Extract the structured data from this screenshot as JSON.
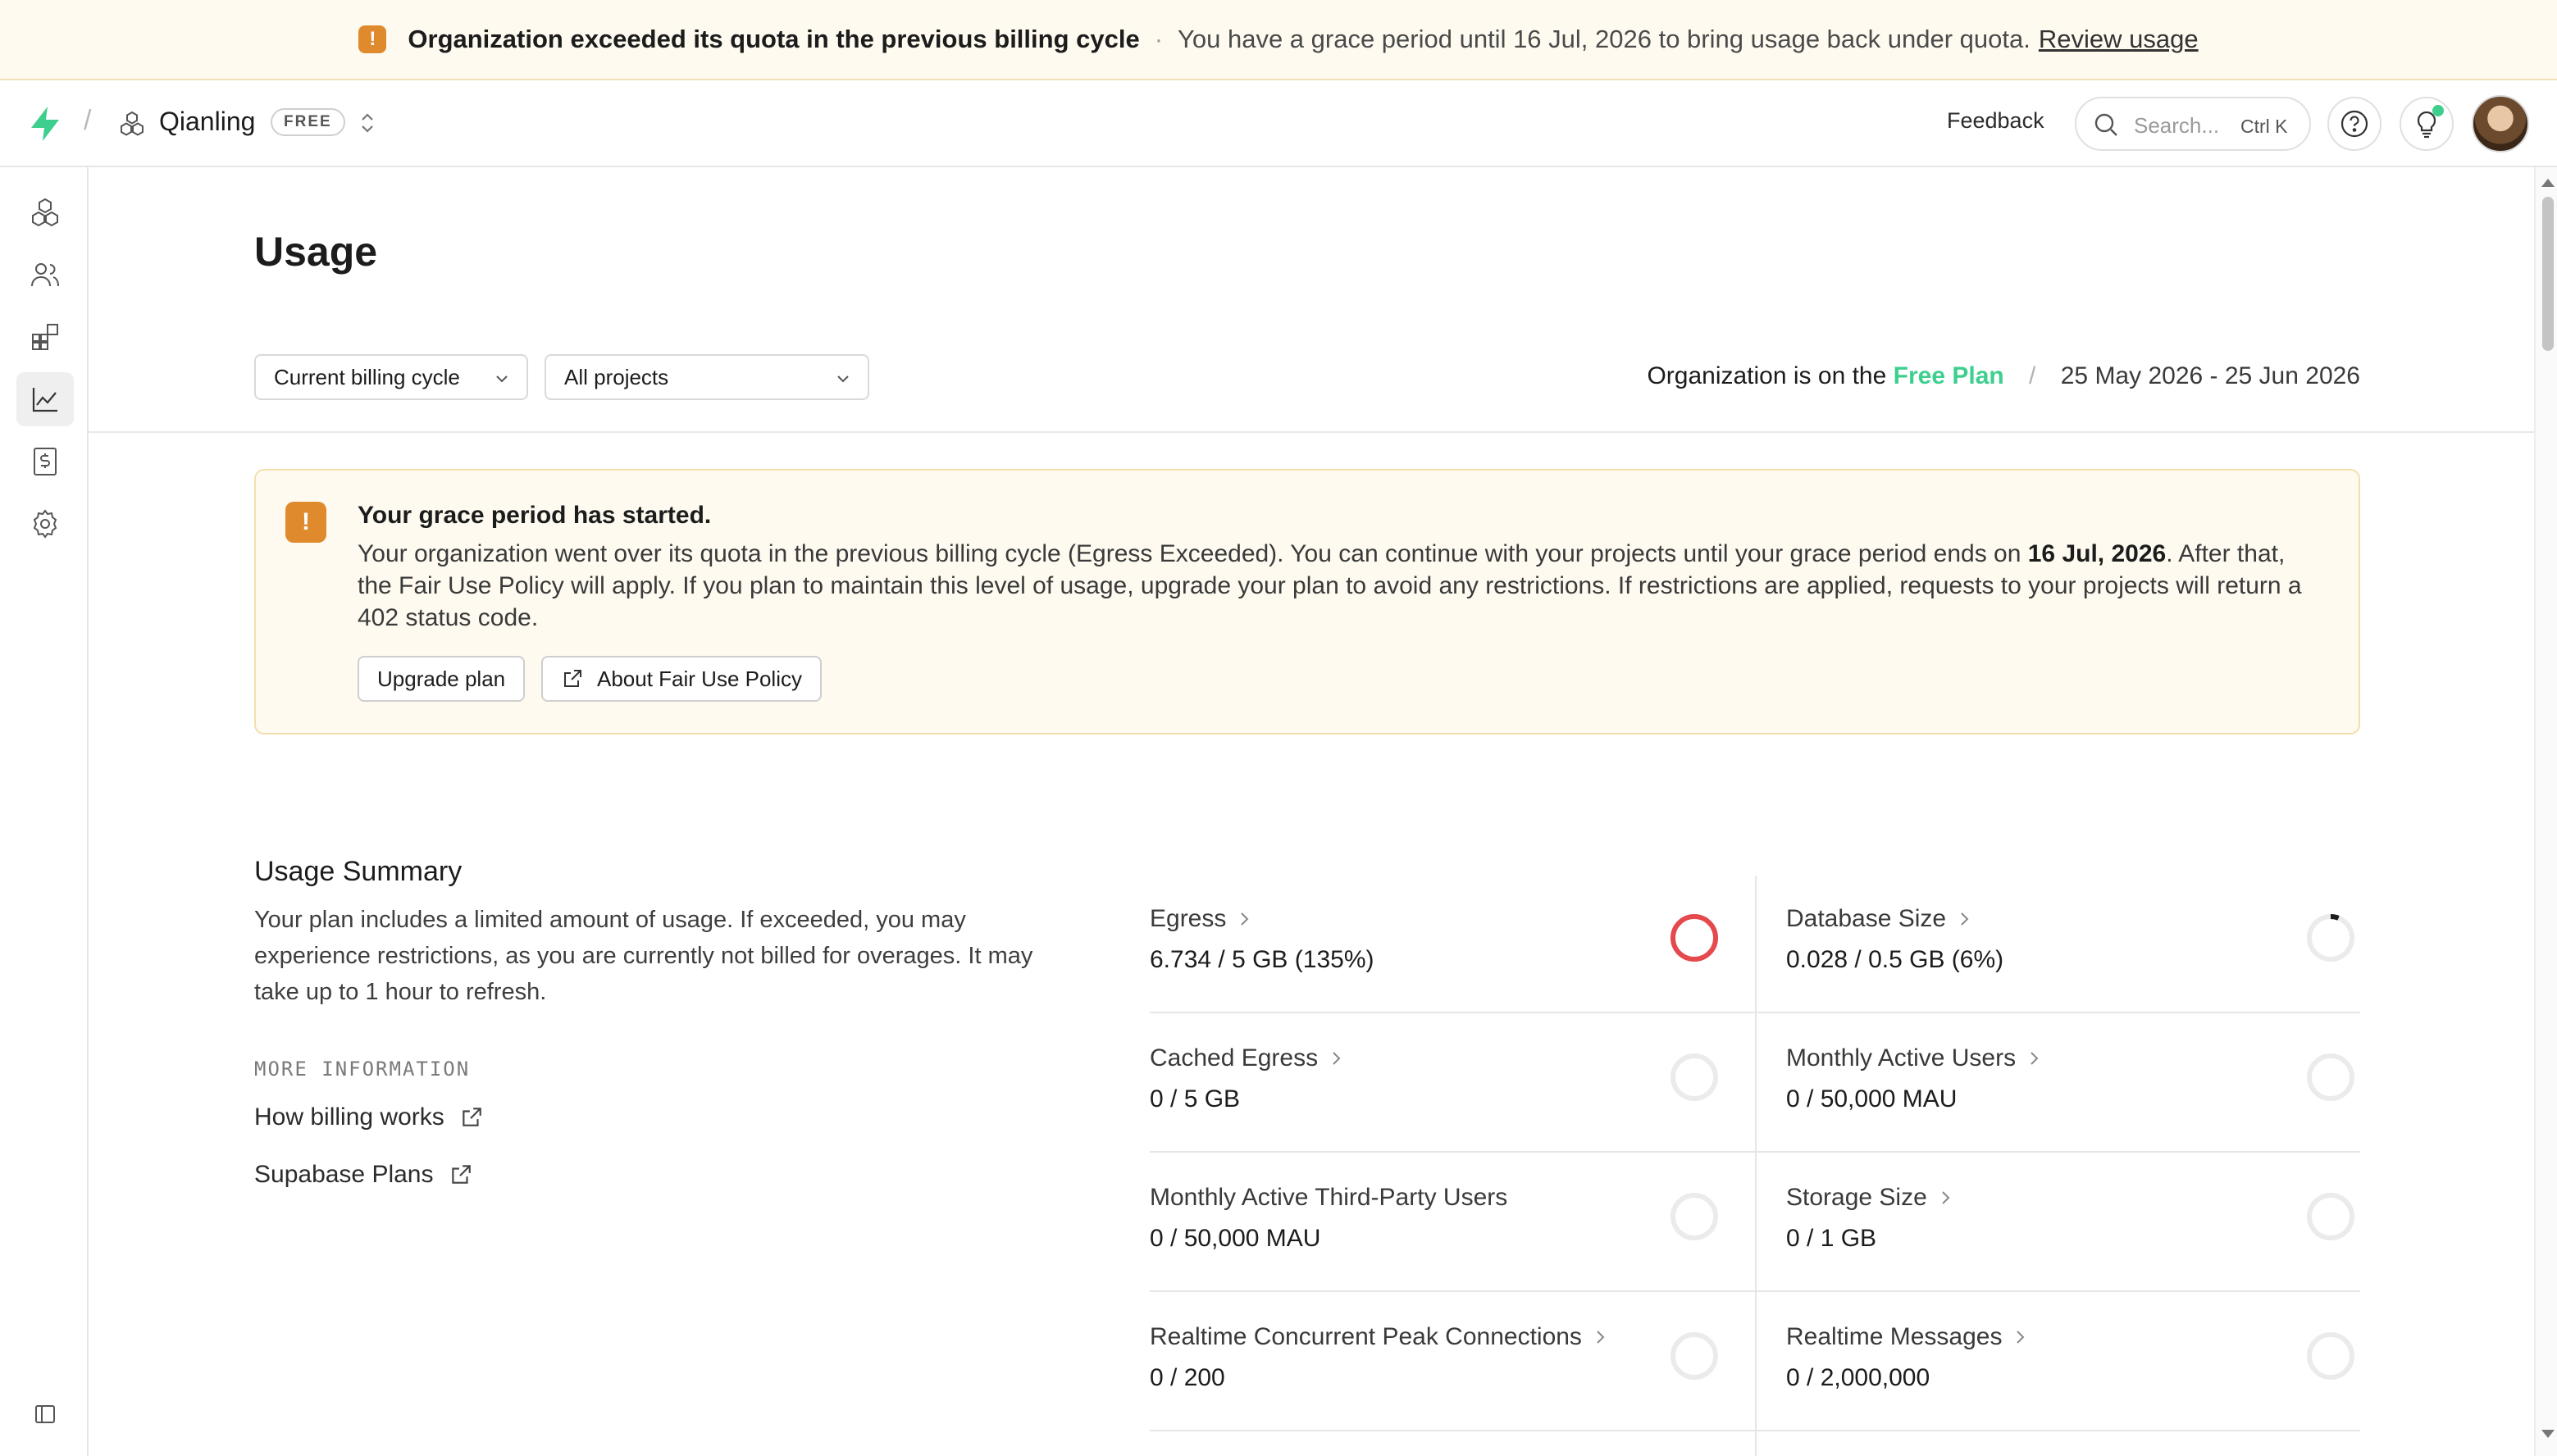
{
  "banner": {
    "title": "Organization exceeded its quota in the previous billing cycle",
    "separator": "·",
    "message": "You have a grace period until 16 Jul, 2026 to bring usage back under quota.",
    "link": "Review usage"
  },
  "topbar": {
    "org_name": "Qianling",
    "plan_badge": "FREE",
    "feedback": "Feedback",
    "search_placeholder": "Search...",
    "search_shortcut": "Ctrl K"
  },
  "sidebar": {
    "items": [
      "projects-icon",
      "team-icon",
      "integrations-icon",
      "usage-icon",
      "billing-icon",
      "settings-icon"
    ],
    "active": "usage-icon"
  },
  "page": {
    "title": "Usage",
    "billing_cycle_select": "Current billing cycle",
    "projects_select": "All projects",
    "plan_prefix": "Organization is on the",
    "plan_name": "Free Plan",
    "plan_sep": "/",
    "date_range": "25 May 2026 - 25 Jun 2026"
  },
  "alert": {
    "title": "Your grace period has started.",
    "body_before": "Your organization went over its quota in the previous billing cycle (Egress Exceeded). You can continue with your projects until your grace period ends on ",
    "body_date": "16 Jul, 2026",
    "body_after": ". After that, the Fair Use Policy will apply. If you plan to maintain this level of usage, upgrade your plan to avoid any restrictions. If restrictions are applied, requests to your projects will return a 402 status code.",
    "upgrade_button": "Upgrade plan",
    "policy_button": "About Fair Use Policy"
  },
  "summary": {
    "title": "Usage Summary",
    "description": "Your plan includes a limited amount of usage. If exceeded, you may experience restrictions, as you are currently not billed for overages. It may take up to 1 hour to refresh.",
    "more_info_label": "MORE INFORMATION",
    "links": [
      "How billing works",
      "Supabase Plans"
    ],
    "metrics": [
      {
        "name": "Egress",
        "value": "6.734 / 5 GB (135%)",
        "has_chevron": true,
        "usage": 1.35,
        "status_color": "#e5484d"
      },
      {
        "name": "Database Size",
        "value": "0.028 / 0.5 GB (6%)",
        "has_chevron": true,
        "usage": 0.06,
        "status_color": "#1c1c1c"
      },
      {
        "name": "Cached Egress",
        "value": "0 / 5 GB",
        "has_chevron": true,
        "usage": 0
      },
      {
        "name": "Monthly Active Users",
        "value": "0 / 50,000 MAU",
        "has_chevron": true,
        "usage": 0
      },
      {
        "name": "Monthly Active Third-Party Users",
        "value": "0 / 50,000 MAU",
        "has_chevron": false,
        "usage": 0
      },
      {
        "name": "Storage Size",
        "value": "0 / 1 GB",
        "has_chevron": true,
        "usage": 0
      },
      {
        "name": "Realtime Concurrent Peak Connections",
        "value": "0 / 200",
        "has_chevron": true,
        "usage": 0
      },
      {
        "name": "Realtime Messages",
        "value": "0 / 2,000,000",
        "has_chevron": true,
        "usage": 0
      }
    ]
  },
  "colors": {
    "brand": "#3ecf8e",
    "warning": "#e08a2e",
    "danger": "#e5484d"
  }
}
